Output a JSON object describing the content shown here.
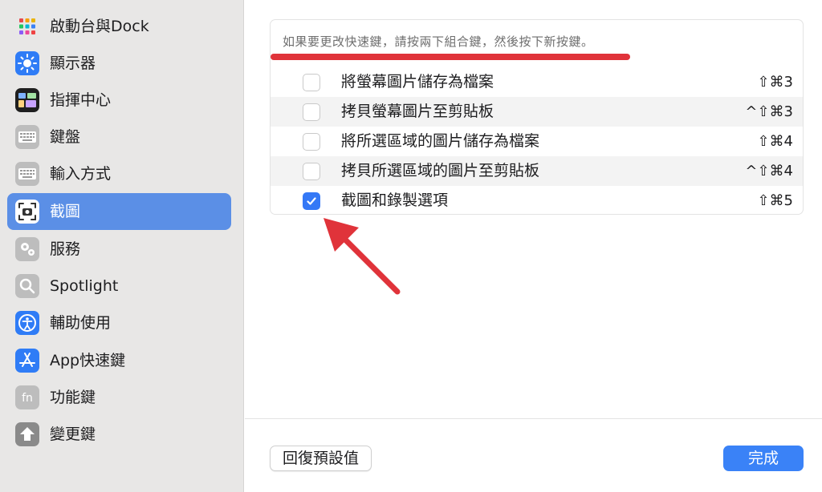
{
  "sidebar": {
    "items": [
      {
        "label": "啟動台與Dock",
        "icon": "launchpad-icon"
      },
      {
        "label": "顯示器",
        "icon": "display-icon"
      },
      {
        "label": "指揮中心",
        "icon": "mission-control-icon"
      },
      {
        "label": "鍵盤",
        "icon": "keyboard-icon"
      },
      {
        "label": "輸入方式",
        "icon": "input-keyboard-icon"
      },
      {
        "label": "截圖",
        "icon": "screenshot-icon"
      },
      {
        "label": "服務",
        "icon": "gears-icon"
      },
      {
        "label": "Spotlight",
        "icon": "magnifier-icon"
      },
      {
        "label": "輔助使用",
        "icon": "accessibility-icon"
      },
      {
        "label": "App快速鍵",
        "icon": "app-store-icon"
      },
      {
        "label": "功能鍵",
        "icon": "fn-key-icon"
      },
      {
        "label": "變更鍵",
        "icon": "modifier-key-icon"
      }
    ],
    "selected": "截圖"
  },
  "panel": {
    "hint": "如果要更改快速鍵，請按兩下組合鍵，然後按下新按鍵。",
    "rows": [
      {
        "label": "將螢幕圖片儲存為檔案",
        "shortcut": "⇧⌘3",
        "checked": false
      },
      {
        "label": "拷貝螢幕圖片至剪貼板",
        "shortcut": "^⇧⌘3",
        "checked": false
      },
      {
        "label": "將所選區域的圖片儲存為檔案",
        "shortcut": "⇧⌘4",
        "checked": false
      },
      {
        "label": "拷貝所選區域的圖片至剪貼板",
        "shortcut": "^⇧⌘4",
        "checked": false
      },
      {
        "label": "截圖和錄製選項",
        "shortcut": "⇧⌘5",
        "checked": true
      }
    ]
  },
  "buttons": {
    "restore_label": "回復預設值",
    "done_label": "完成"
  },
  "colors": {
    "accent": "#3a82f7",
    "selected_sidebar": "#5b8fe6",
    "annotation_red": "#e0333a"
  }
}
